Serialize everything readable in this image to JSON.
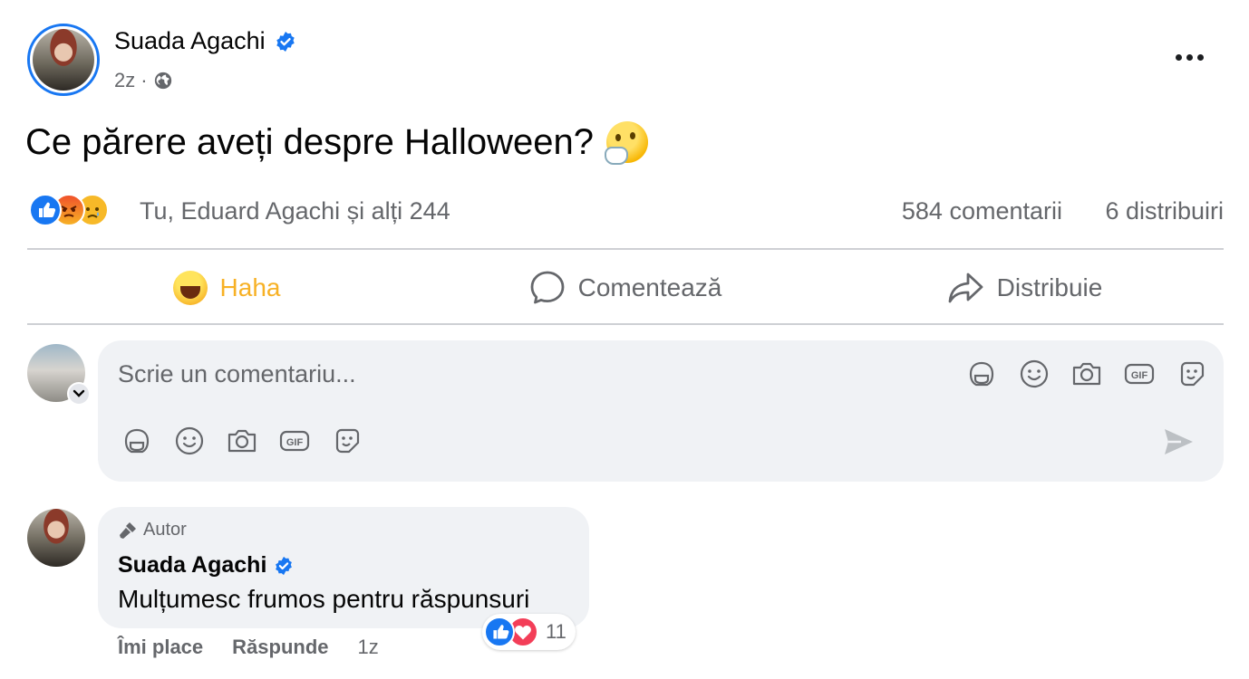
{
  "post": {
    "author": "Suada Agachi",
    "time": "2z",
    "separator": "·",
    "text": "Ce părere aveți despre Halloween?",
    "emoji": "thinking-face-icon"
  },
  "stats": {
    "reactions_summary": "Tu, Eduard Agachi și alți 244",
    "comments": "584 comentarii",
    "shares": "6 distribuiri"
  },
  "actions": {
    "haha": "Haha",
    "comment": "Comentează",
    "share": "Distribuie"
  },
  "composer": {
    "placeholder": "Scrie un comentariu..."
  },
  "comment": {
    "badge": "Autor",
    "author": "Suada Agachi",
    "text": "Mulțumesc frumos pentru răspunsuri",
    "reaction_count": "11",
    "like_label": "Îmi place",
    "reply_label": "Răspunde",
    "time": "1z"
  },
  "colors": {
    "accent": "#1877f2",
    "haha": "#f7b125",
    "muted_text": "#65676b",
    "bubble_bg": "#f0f2f5"
  }
}
